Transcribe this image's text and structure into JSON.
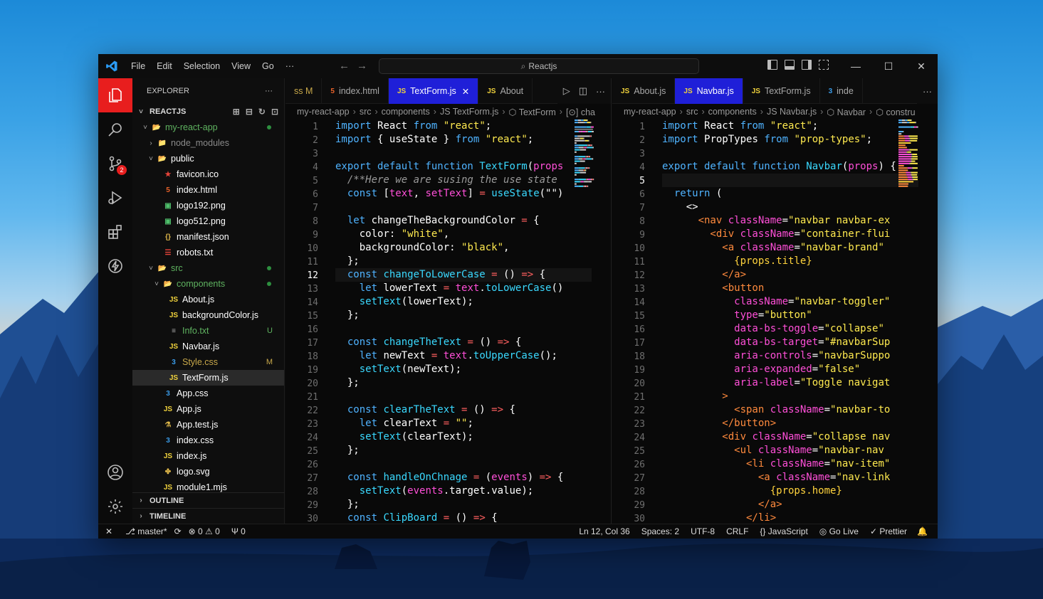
{
  "colors": {
    "accent": "#e81e1e",
    "tab_active": "#1f1fd8",
    "git_modified": "#c8a84a",
    "git_untracked": "#5fb360"
  },
  "titlebar": {
    "menu": [
      "File",
      "Edit",
      "Selection",
      "View",
      "Go",
      "···"
    ],
    "search": "Reactjs",
    "icon": "vscode-logo"
  },
  "activity": [
    "explorer-icon",
    "search-icon",
    "source-control-icon",
    "run-debug-icon",
    "extensions-icon",
    "lightning-icon"
  ],
  "activity_bottom": [
    "account-icon",
    "settings-gear-icon"
  ],
  "scm_badge": "2",
  "sidebar": {
    "title": "EXPLORER",
    "more": "···",
    "section": "REACTJS",
    "tree": [
      {
        "name": "my-react-app",
        "icon": "📂",
        "color": "#5fb360",
        "depth": 1,
        "tw": "˅",
        "dot": true
      },
      {
        "name": "node_modules",
        "icon": "📁",
        "color": "#8a8a8a",
        "depth": 2,
        "tw": "›"
      },
      {
        "name": "public",
        "icon": "📂",
        "color": "#ffffff",
        "depth": 2,
        "tw": "˅"
      },
      {
        "name": "favicon.ico",
        "icon": "★",
        "color": "#ffffff",
        "ic": "#e8443a",
        "depth": 3
      },
      {
        "name": "index.html",
        "icon": "5",
        "color": "#ffffff",
        "ic": "#e8622a",
        "depth": 3
      },
      {
        "name": "logo192.png",
        "icon": "▣",
        "color": "#ffffff",
        "ic": "#4fbf6b",
        "depth": 3
      },
      {
        "name": "logo512.png",
        "icon": "▣",
        "color": "#ffffff",
        "ic": "#4fbf6b",
        "depth": 3
      },
      {
        "name": "manifest.json",
        "icon": "{}",
        "color": "#ffffff",
        "ic": "#e0b84a",
        "depth": 3
      },
      {
        "name": "robots.txt",
        "icon": "☰",
        "color": "#ffffff",
        "ic": "#e8443a",
        "depth": 3
      },
      {
        "name": "src",
        "icon": "📂",
        "color": "#5fb360",
        "depth": 2,
        "tw": "˅",
        "dot": true
      },
      {
        "name": "components",
        "icon": "📂",
        "color": "#5fb360",
        "depth": 3,
        "tw": "˅",
        "dot": true
      },
      {
        "name": "About.js",
        "icon": "JS",
        "color": "#ffffff",
        "ic": "#f0d23c",
        "depth": 4
      },
      {
        "name": "backgroundColor.js",
        "icon": "JS",
        "color": "#ffffff",
        "ic": "#f0d23c",
        "depth": 4
      },
      {
        "name": "Info.txt",
        "icon": "≡",
        "color": "#5fb360",
        "ic": "#aaaaaa",
        "depth": 4,
        "status": "U"
      },
      {
        "name": "Navbar.js",
        "icon": "JS",
        "color": "#ffffff",
        "ic": "#f0d23c",
        "depth": 4
      },
      {
        "name": "Style.css",
        "icon": "3",
        "color": "#c8a84a",
        "ic": "#3a9be8",
        "depth": 4,
        "status": "M"
      },
      {
        "name": "TextForm.js",
        "icon": "JS",
        "color": "#ffffff",
        "ic": "#f0d23c",
        "depth": 4,
        "selected": true
      },
      {
        "name": "App.css",
        "icon": "3",
        "color": "#ffffff",
        "ic": "#3a9be8",
        "depth": 3
      },
      {
        "name": "App.js",
        "icon": "JS",
        "color": "#ffffff",
        "ic": "#f0d23c",
        "depth": 3
      },
      {
        "name": "App.test.js",
        "icon": "⚗",
        "color": "#ffffff",
        "ic": "#e0b84a",
        "depth": 3
      },
      {
        "name": "index.css",
        "icon": "3",
        "color": "#ffffff",
        "ic": "#3a9be8",
        "depth": 3
      },
      {
        "name": "index.js",
        "icon": "JS",
        "color": "#ffffff",
        "ic": "#f0d23c",
        "depth": 3
      },
      {
        "name": "logo.svg",
        "icon": "✤",
        "color": "#ffffff",
        "ic": "#e0b84a",
        "depth": 3
      },
      {
        "name": "module1.mjs",
        "icon": "JS",
        "color": "#ffffff",
        "ic": "#f0d23c",
        "depth": 3
      }
    ],
    "outline": "OUTLINE",
    "timeline": "TIMELINE"
  },
  "left_editor": {
    "tabs": [
      {
        "label": "ss M",
        "icon": "",
        "ic": "#c8a84a",
        "color": "#c8a84a"
      },
      {
        "label": "index.html",
        "icon": "5",
        "ic": "#e8622a"
      },
      {
        "label": "TextForm.js",
        "icon": "JS",
        "ic": "#f0d23c",
        "active": true,
        "close": "✕"
      },
      {
        "label": "About",
        "icon": "JS",
        "ic": "#f0d23c"
      }
    ],
    "crumbs": [
      "my-react-app",
      "src",
      "components",
      "JS TextForm.js",
      "⬡ TextForm",
      "[⊙] cha"
    ],
    "cursor_line": 12,
    "lines": [
      [
        [
          "k",
          "import "
        ],
        [
          "t",
          "React "
        ],
        [
          "k",
          "from "
        ],
        [
          "s",
          "\"react\""
        ],
        [
          "t",
          ";"
        ]
      ],
      [
        [
          "k",
          "import "
        ],
        [
          "t",
          "{ "
        ],
        [
          "t",
          "useState "
        ],
        [
          "t",
          "} "
        ],
        [
          "k",
          "from "
        ],
        [
          "s",
          "\"react\""
        ],
        [
          "t",
          ";"
        ]
      ],
      [],
      [
        [
          "k",
          "export default function "
        ],
        [
          "f",
          "TextForm"
        ],
        [
          "t",
          "("
        ],
        [
          "v",
          "props"
        ]
      ],
      [
        [
          "c",
          "  /**Here we are susing the use state"
        ]
      ],
      [
        [
          "k",
          "  const "
        ],
        [
          "t",
          "["
        ],
        [
          "v",
          "text"
        ],
        [
          "t",
          ", "
        ],
        [
          "v",
          "setText"
        ],
        [
          "t",
          "] "
        ],
        [
          "p",
          "= "
        ],
        [
          "f",
          "useState"
        ],
        [
          "t",
          "(\"\")"
        ]
      ],
      [],
      [
        [
          "k",
          "  let "
        ],
        [
          "t",
          "changeTheBackgroundColor "
        ],
        [
          "p",
          "= "
        ],
        [
          "t",
          "{"
        ]
      ],
      [
        [
          "t",
          "    color"
        ],
        [
          "t",
          ": "
        ],
        [
          "s",
          "\"white\""
        ],
        [
          "t",
          ","
        ]
      ],
      [
        [
          "t",
          "    backgroundColor"
        ],
        [
          "t",
          ": "
        ],
        [
          "s",
          "\"black\""
        ],
        [
          "t",
          ","
        ]
      ],
      [
        [
          "t",
          "  };"
        ]
      ],
      [
        [
          "k",
          "  const "
        ],
        [
          "f",
          "changeToLowerCase "
        ],
        [
          "p",
          "= "
        ],
        [
          "t",
          "() "
        ],
        [
          "p",
          "=> "
        ],
        [
          "t",
          "{"
        ]
      ],
      [
        [
          "k",
          "    let "
        ],
        [
          "t",
          "lowerText "
        ],
        [
          "p",
          "= "
        ],
        [
          "v",
          "text"
        ],
        [
          "t",
          "."
        ],
        [
          "f",
          "toLowerCase"
        ],
        [
          "t",
          "()"
        ]
      ],
      [
        [
          "f",
          "    setText"
        ],
        [
          "t",
          "(lowerText);"
        ]
      ],
      [
        [
          "t",
          "  };"
        ]
      ],
      [],
      [
        [
          "k",
          "  const "
        ],
        [
          "f",
          "changeTheText "
        ],
        [
          "p",
          "= "
        ],
        [
          "t",
          "() "
        ],
        [
          "p",
          "=> "
        ],
        [
          "t",
          "{"
        ]
      ],
      [
        [
          "k",
          "    let "
        ],
        [
          "t",
          "newText "
        ],
        [
          "p",
          "= "
        ],
        [
          "v",
          "text"
        ],
        [
          "t",
          "."
        ],
        [
          "f",
          "toUpperCase"
        ],
        [
          "t",
          "();"
        ]
      ],
      [
        [
          "f",
          "    setText"
        ],
        [
          "t",
          "(newText);"
        ]
      ],
      [
        [
          "t",
          "  };"
        ]
      ],
      [],
      [
        [
          "k",
          "  const "
        ],
        [
          "f",
          "clearTheText "
        ],
        [
          "p",
          "= "
        ],
        [
          "t",
          "() "
        ],
        [
          "p",
          "=> "
        ],
        [
          "t",
          "{"
        ]
      ],
      [
        [
          "k",
          "    let "
        ],
        [
          "t",
          "clearText "
        ],
        [
          "p",
          "= "
        ],
        [
          "s",
          "\"\""
        ],
        [
          "t",
          ";"
        ]
      ],
      [
        [
          "f",
          "    setText"
        ],
        [
          "t",
          "(clearText);"
        ]
      ],
      [
        [
          "t",
          "  };"
        ]
      ],
      [],
      [
        [
          "k",
          "  const "
        ],
        [
          "f",
          "handleOnChnage "
        ],
        [
          "p",
          "= "
        ],
        [
          "t",
          "("
        ],
        [
          "v",
          "events"
        ],
        [
          "t",
          ") "
        ],
        [
          "p",
          "=> "
        ],
        [
          "t",
          "{"
        ]
      ],
      [
        [
          "f",
          "    setText"
        ],
        [
          "t",
          "("
        ],
        [
          "v",
          "events"
        ],
        [
          "t",
          "."
        ],
        [
          "t",
          "target"
        ],
        [
          "t",
          "."
        ],
        [
          "t",
          "value);"
        ]
      ],
      [
        [
          "t",
          "  };"
        ]
      ],
      [
        [
          "k",
          "  const "
        ],
        [
          "f",
          "ClipBoard "
        ],
        [
          "p",
          "= "
        ],
        [
          "t",
          "() "
        ],
        [
          "p",
          "=> "
        ],
        [
          "t",
          "{"
        ]
      ]
    ]
  },
  "right_editor": {
    "tabs": [
      {
        "label": "About.js",
        "icon": "JS",
        "ic": "#f0d23c"
      },
      {
        "label": "Navbar.js",
        "icon": "JS",
        "ic": "#f0d23c",
        "active": true
      },
      {
        "label": "TextForm.js",
        "icon": "JS",
        "ic": "#f0d23c"
      },
      {
        "label": "inde",
        "icon": "3",
        "ic": "#3a9be8"
      }
    ],
    "crumbs": [
      "my-react-app",
      "src",
      "components",
      "JS Navbar.js",
      "⬡ Navbar",
      "⬡ constru"
    ],
    "cursor_line": 5,
    "lines": [
      [
        [
          "k",
          "import "
        ],
        [
          "t",
          "React "
        ],
        [
          "k",
          "from "
        ],
        [
          "s",
          "\"react\""
        ],
        [
          "t",
          ";"
        ]
      ],
      [
        [
          "k",
          "import "
        ],
        [
          "t",
          "PropTypes "
        ],
        [
          "k",
          "from "
        ],
        [
          "s",
          "\"prop-types\""
        ],
        [
          "t",
          ";"
        ]
      ],
      [],
      [
        [
          "k",
          "export default function "
        ],
        [
          "f",
          "Navbar"
        ],
        [
          "t",
          "("
        ],
        [
          "v",
          "props"
        ],
        [
          "t",
          ") {"
        ]
      ],
      [],
      [
        [
          "k",
          "  return "
        ],
        [
          "t",
          "("
        ]
      ],
      [
        [
          "t",
          "    <>"
        ]
      ],
      [
        [
          "o",
          "      <nav "
        ],
        [
          "v",
          "className"
        ],
        [
          "t",
          "="
        ],
        [
          "s",
          "\"navbar navbar-ex"
        ]
      ],
      [
        [
          "o",
          "        <div "
        ],
        [
          "v",
          "className"
        ],
        [
          "t",
          "="
        ],
        [
          "s",
          "\"container-flui"
        ]
      ],
      [
        [
          "o",
          "          <a "
        ],
        [
          "v",
          "className"
        ],
        [
          "t",
          "="
        ],
        [
          "s",
          "\"navbar-brand\""
        ]
      ],
      [
        [
          "y",
          "            {props.title}"
        ]
      ],
      [
        [
          "o",
          "          </a>"
        ]
      ],
      [
        [
          "o",
          "          <button"
        ]
      ],
      [
        [
          "v",
          "            className"
        ],
        [
          "t",
          "="
        ],
        [
          "s",
          "\"navbar-toggler\""
        ]
      ],
      [
        [
          "v",
          "            type"
        ],
        [
          "t",
          "="
        ],
        [
          "s",
          "\"button\""
        ]
      ],
      [
        [
          "v",
          "            data-bs-toggle"
        ],
        [
          "t",
          "="
        ],
        [
          "s",
          "\"collapse\""
        ]
      ],
      [
        [
          "v",
          "            data-bs-target"
        ],
        [
          "t",
          "="
        ],
        [
          "s",
          "\"#navbarSup"
        ]
      ],
      [
        [
          "v",
          "            aria-controls"
        ],
        [
          "t",
          "="
        ],
        [
          "s",
          "\"navbarSuppo"
        ]
      ],
      [
        [
          "v",
          "            aria-expanded"
        ],
        [
          "t",
          "="
        ],
        [
          "s",
          "\"false\""
        ]
      ],
      [
        [
          "v",
          "            aria-label"
        ],
        [
          "t",
          "="
        ],
        [
          "s",
          "\"Toggle navigat"
        ]
      ],
      [
        [
          "o",
          "          >"
        ]
      ],
      [
        [
          "o",
          "            <span "
        ],
        [
          "v",
          "className"
        ],
        [
          "t",
          "="
        ],
        [
          "s",
          "\"navbar-to"
        ]
      ],
      [
        [
          "o",
          "          </button>"
        ]
      ],
      [
        [
          "o",
          "          <div "
        ],
        [
          "v",
          "className"
        ],
        [
          "t",
          "="
        ],
        [
          "s",
          "\"collapse nav"
        ]
      ],
      [
        [
          "o",
          "            <ul "
        ],
        [
          "v",
          "className"
        ],
        [
          "t",
          "="
        ],
        [
          "s",
          "\"navbar-nav"
        ]
      ],
      [
        [
          "o",
          "              <li "
        ],
        [
          "v",
          "className"
        ],
        [
          "t",
          "="
        ],
        [
          "s",
          "\"nav-item\""
        ]
      ],
      [
        [
          "o",
          "                <a "
        ],
        [
          "v",
          "className"
        ],
        [
          "t",
          "="
        ],
        [
          "s",
          "\"nav-link"
        ]
      ],
      [
        [
          "y",
          "                  {props.home}"
        ]
      ],
      [
        [
          "o",
          "                </a>"
        ]
      ],
      [
        [
          "o",
          "              </li>"
        ]
      ]
    ]
  },
  "status": {
    "left": [
      "✕",
      "⎇ master*",
      "⟳",
      "⊗ 0 ⚠ 0",
      "Ψ 0"
    ],
    "right": [
      "Ln 12, Col 36",
      "Spaces: 2",
      "UTF-8",
      "CRLF",
      "{} JavaScript",
      "◎ Go Live",
      "✓ Prettier",
      "🔔"
    ]
  }
}
